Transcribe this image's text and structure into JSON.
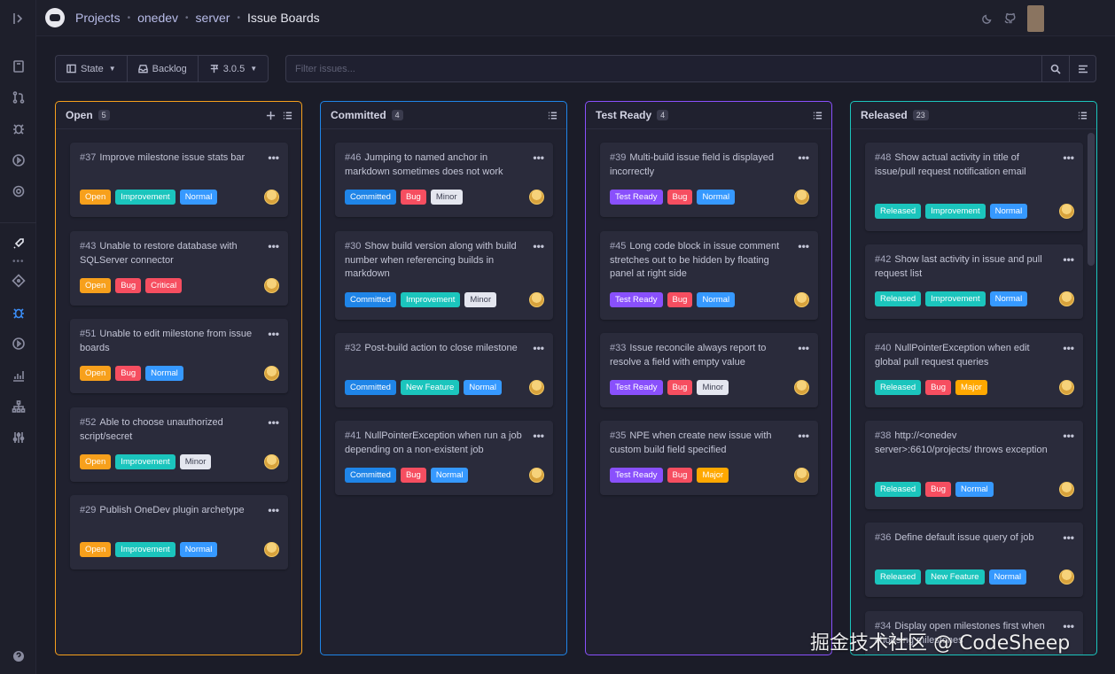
{
  "breadcrumb": {
    "projects": "Projects",
    "project": "onedev",
    "child": "server",
    "current": "Issue Boards"
  },
  "toolbar": {
    "state": "State",
    "backlog": "Backlog",
    "milestone": "3.0.5"
  },
  "filter": {
    "placeholder": "Filter issues..."
  },
  "tag_colors": {
    "Open": "#f7a01c",
    "Committed": "#1f85e8",
    "Test Ready": "#8950fc",
    "Released": "#1bc5bd",
    "Improvement": "#1bc5bd",
    "New Feature": "#1bc5bd",
    "Bug": "#f64e60",
    "Normal": "#3699ff",
    "Critical": "#f64e60",
    "Major": "#ffa800",
    "Minor": "#e4e6ef"
  },
  "columns": [
    {
      "title": "Open",
      "count": "5",
      "color": "#f7a01c",
      "cards": [
        {
          "num": "#37",
          "title": "Improve milestone issue stats bar",
          "tags": [
            "Open",
            "Improvement",
            "Normal"
          ]
        },
        {
          "num": "#43",
          "title": "Unable to restore database with SQLServer connector",
          "tags": [
            "Open",
            "Bug",
            "Critical"
          ]
        },
        {
          "num": "#51",
          "title": "Unable to edit milestone from issue boards",
          "tags": [
            "Open",
            "Bug",
            "Normal"
          ]
        },
        {
          "num": "#52",
          "title": "Able to choose unauthorized script/secret",
          "tags": [
            "Open",
            "Improvement",
            "Minor"
          ]
        },
        {
          "num": "#29",
          "title": "Publish OneDev plugin archetype",
          "tags": [
            "Open",
            "Improvement",
            "Normal"
          ]
        }
      ]
    },
    {
      "title": "Committed",
      "count": "4",
      "color": "#1f85e8",
      "cards": [
        {
          "num": "#46",
          "title": "Jumping to named anchor in markdown sometimes does not work",
          "tags": [
            "Committed",
            "Bug",
            "Minor"
          ]
        },
        {
          "num": "#30",
          "title": "Show build version along with build number when referencing builds in markdown",
          "tags": [
            "Committed",
            "Improvement",
            "Minor"
          ]
        },
        {
          "num": "#32",
          "title": "Post-build action to close milestone",
          "tags": [
            "Committed",
            "New Feature",
            "Normal"
          ]
        },
        {
          "num": "#41",
          "title": "NullPointerException when run a job depending on a non-existent job",
          "tags": [
            "Committed",
            "Bug",
            "Normal"
          ]
        }
      ]
    },
    {
      "title": "Test Ready",
      "count": "4",
      "color": "#8950fc",
      "cards": [
        {
          "num": "#39",
          "title": "Multi-build issue field is displayed incorrectly",
          "tags": [
            "Test Ready",
            "Bug",
            "Normal"
          ]
        },
        {
          "num": "#45",
          "title": "Long code block in issue comment stretches out to be hidden by floating panel at right side",
          "tags": [
            "Test Ready",
            "Bug",
            "Normal"
          ]
        },
        {
          "num": "#33",
          "title": "Issue reconcile always report to resolve a field with empty value",
          "tags": [
            "Test Ready",
            "Bug",
            "Minor"
          ]
        },
        {
          "num": "#35",
          "title": "NPE when create new issue with custom build field specified",
          "tags": [
            "Test Ready",
            "Bug",
            "Major"
          ]
        }
      ]
    },
    {
      "title": "Released",
      "count": "23",
      "color": "#1bc5bd",
      "cards": [
        {
          "num": "#48",
          "title": "Show actual activity in title of issue/pull request notification email",
          "tags": [
            "Released",
            "Improvement",
            "Normal"
          ]
        },
        {
          "num": "#42",
          "title": "Show last activity in issue and pull request list",
          "tags": [
            "Released",
            "Improvement",
            "Normal"
          ]
        },
        {
          "num": "#40",
          "title": "NullPointerException when edit global pull request queries",
          "tags": [
            "Released",
            "Bug",
            "Major"
          ]
        },
        {
          "num": "#38",
          "title": "http://<onedev server>:6610/projects/ throws exception",
          "tags": [
            "Released",
            "Bug",
            "Normal"
          ]
        },
        {
          "num": "#36",
          "title": "Define default issue query of job",
          "tags": [
            "Released",
            "New Feature",
            "Normal"
          ]
        },
        {
          "num": "#34",
          "title": "Display open milestones first when choosing milestones",
          "tags": []
        }
      ]
    }
  ],
  "watermark": "掘金技术社区 @ CodeSheep"
}
